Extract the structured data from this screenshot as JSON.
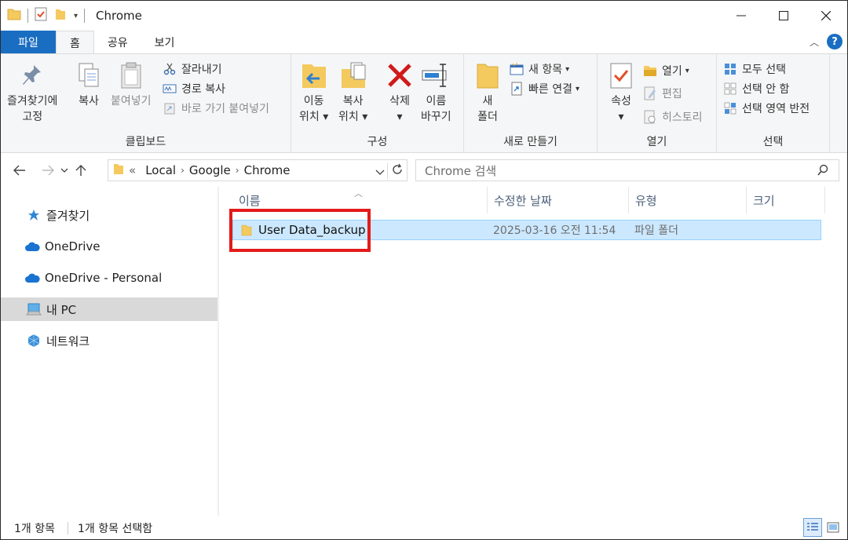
{
  "window": {
    "title": "Chrome"
  },
  "tabs": {
    "file": "파일",
    "home": "홈",
    "share": "공유",
    "view": "보기"
  },
  "ribbon": {
    "clipboard": {
      "label": "클립보드",
      "pin_line1": "즐겨찾기에",
      "pin_line2": "고정",
      "copy": "복사",
      "paste": "붙여넣기",
      "cut": "잘라내기",
      "copy_path": "경로 복사",
      "paste_shortcut": "바로 가기 붙여넣기"
    },
    "organize": {
      "label": "구성",
      "move_line1": "이동",
      "move_line2": "위치",
      "copyto_line1": "복사",
      "copyto_line2": "위치",
      "delete": "삭제",
      "rename_line1": "이름",
      "rename_line2": "바꾸기"
    },
    "new": {
      "label": "새로 만들기",
      "folder_line1": "새",
      "folder_line2": "폴더",
      "new_item": "새 항목",
      "easy_access": "빠른 연결"
    },
    "open": {
      "label": "열기",
      "properties": "속성",
      "open": "열기",
      "edit": "편집",
      "history": "히스토리"
    },
    "select": {
      "label": "선택",
      "select_all": "모두 선택",
      "select_none": "선택 안 함",
      "invert": "선택 영역 반전"
    }
  },
  "address": {
    "prefix": "«",
    "crumbs": [
      "Local",
      "Google",
      "Chrome"
    ],
    "search_placeholder": "Chrome 검색"
  },
  "navpane": {
    "items": [
      {
        "label": "즐겨찾기"
      },
      {
        "label": "OneDrive"
      },
      {
        "label": "OneDrive - Personal"
      },
      {
        "label": "내 PC"
      },
      {
        "label": "네트워크"
      }
    ]
  },
  "filelist": {
    "columns": {
      "name": "이름",
      "date": "수정한 날짜",
      "type": "유형",
      "size": "크기"
    },
    "rows": [
      {
        "name": "User Data_backup",
        "date": "2025-03-16 오전 11:54",
        "type": "파일 폴더",
        "size": ""
      }
    ]
  },
  "status": {
    "count": "1개 항목",
    "selected": "1개 항목 선택함"
  },
  "colors": {
    "accent": "#1a6ec2",
    "selection": "#cce8ff",
    "highlight_box": "#e41a1a",
    "folder": "#f4c95d"
  }
}
